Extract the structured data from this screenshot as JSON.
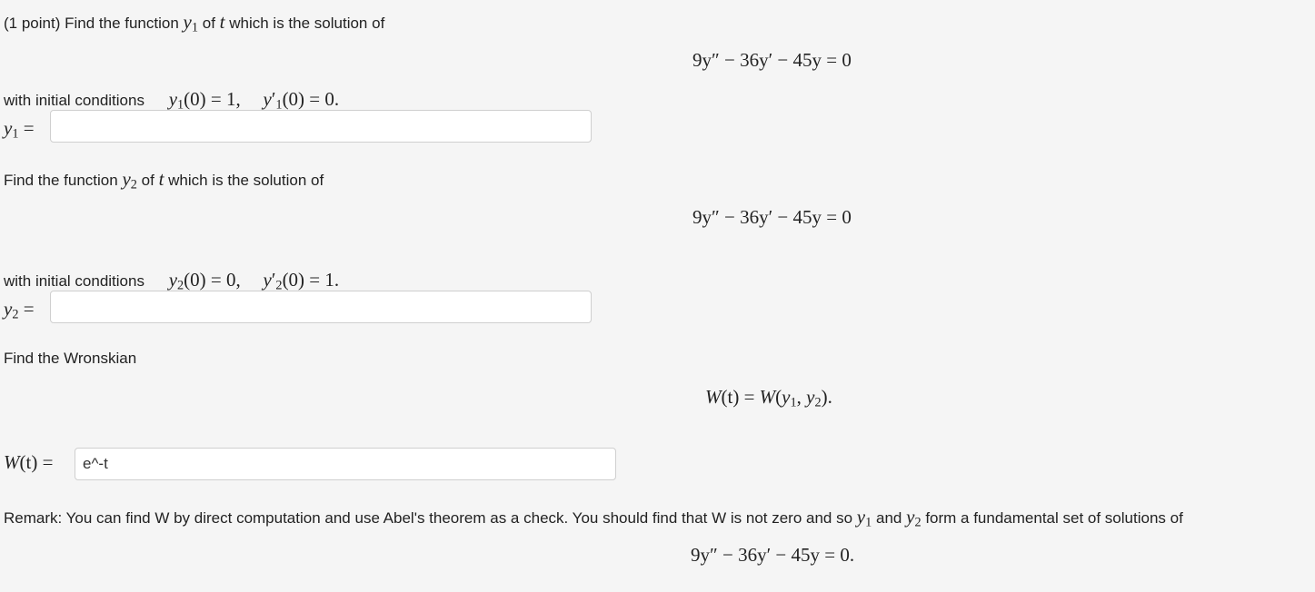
{
  "problem": {
    "points": "(1 point)",
    "part1_intro_a": "Find the function",
    "part1_intro_b": "of",
    "part1_intro_c": "which is the solution of",
    "var_t": "t",
    "y1_sym": "y",
    "sub1": "1",
    "sub2": "2",
    "equation": "9y″ − 36y′ − 45y = 0",
    "equation_final": "9y″ − 36y′ − 45y = 0.",
    "initial_label": "with initial conditions",
    "ic1_a": "(0) = 1,",
    "ic1_b": "(0) = 0.",
    "ic2_a": "(0) = 0,",
    "ic2_b": "(0) = 1.",
    "equals": "=",
    "part2_intro_a": "Find the function",
    "part2_intro_b": "of",
    "part2_intro_c": "which is the solution of",
    "wronskian_title": "Find the Wronskian",
    "wronskian_def_a": "W",
    "wronskian_def_b": "(t) = ",
    "wronskian_def_c": "W",
    "wronskian_def_d": "(",
    "wronskian_def_e": ", ",
    "wronskian_def_f": ").",
    "w_label_a": "W",
    "w_label_b": "(t)",
    "remark_a": "Remark: You can find W by direct computation and use Abel's theorem as a check. You should find that W is not zero and so",
    "remark_b": "and",
    "remark_c": "form a fundamental set of solutions of"
  },
  "answers": {
    "y1_value": "",
    "y2_value": "",
    "w_value": "e^-t"
  }
}
